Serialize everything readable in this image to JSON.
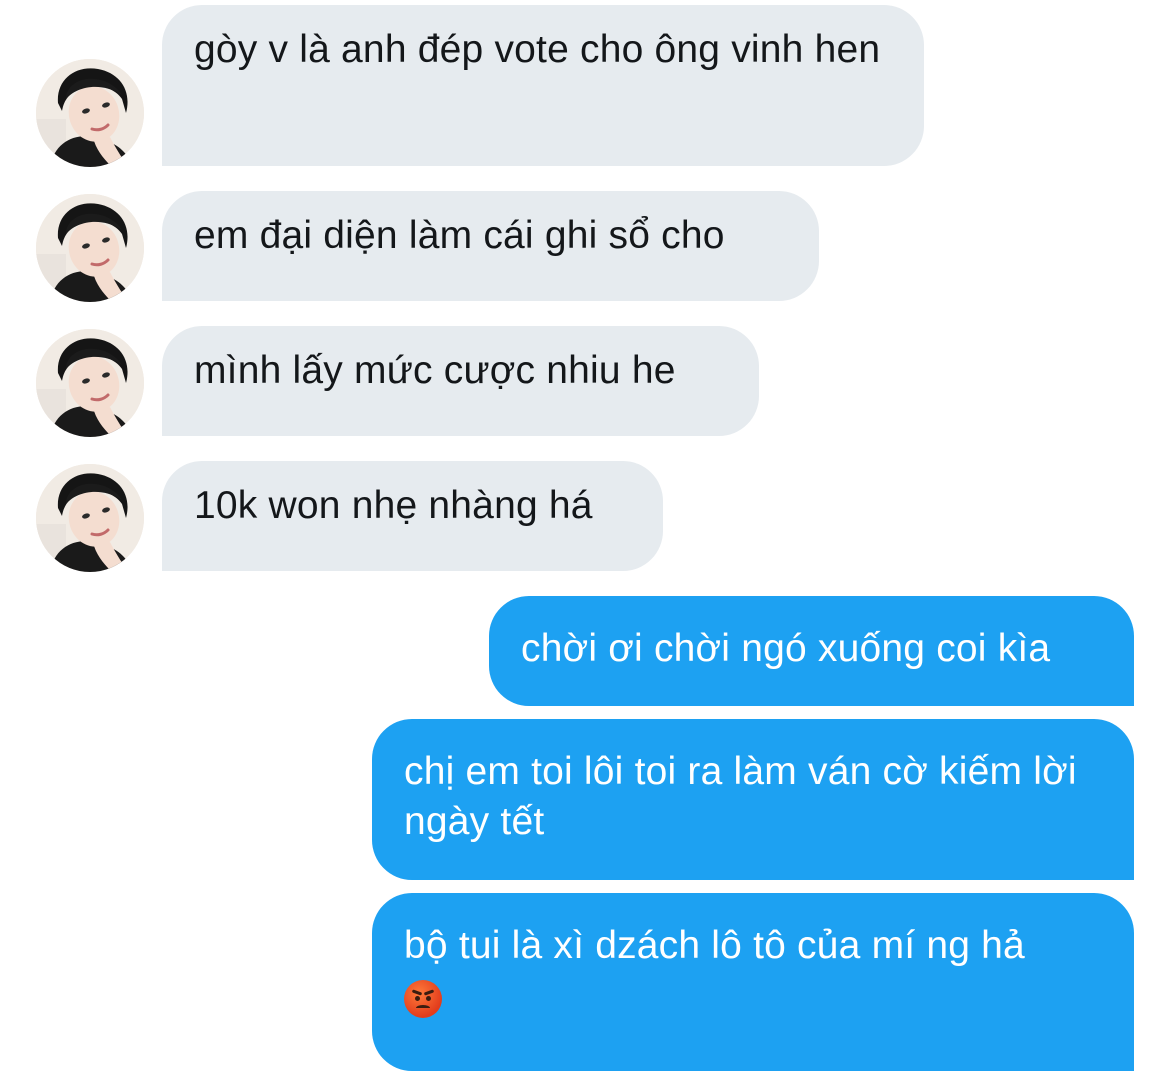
{
  "conversation": {
    "incoming": [
      {
        "text": "gòy v là anh đép vote cho ông vinh hen",
        "avatar_icon": "profile-photo-icon"
      },
      {
        "text": "em đại diện làm cái ghi sổ cho",
        "avatar_icon": "profile-photo-icon"
      },
      {
        "text": "mình lấy mức cược nhiu he",
        "avatar_icon": "profile-photo-icon"
      },
      {
        "text": "10k won nhẹ nhàng há",
        "avatar_icon": "profile-photo-icon"
      }
    ],
    "outgoing": [
      {
        "text": "chời ơi chời ngó xuống coi kìa"
      },
      {
        "text": "chị em toi lôi toi ra làm ván cờ kiếm lời ngày tết"
      },
      {
        "text": "bộ tui là xì dzách lô tô của mí ng hả",
        "emoji": "pouting-face-icon"
      }
    ]
  },
  "colors": {
    "incoming_bubble": "#e6ebef",
    "incoming_text": "#14171a",
    "outgoing_bubble": "#1da1f2",
    "outgoing_text": "#ffffff"
  }
}
